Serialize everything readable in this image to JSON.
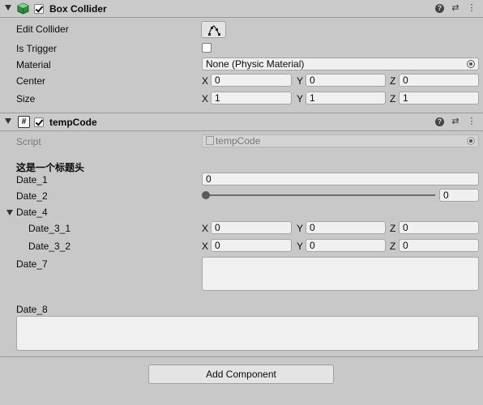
{
  "box_collider": {
    "title": "Box Collider",
    "enabled": true,
    "help_icon": "?",
    "preset_icon": "⇄",
    "menu_icon": "⋮",
    "edit_collider_label": "Edit Collider",
    "edit_collider_icon": "edit-collider-icon",
    "is_trigger_label": "Is Trigger",
    "is_trigger_checked": false,
    "material_label": "Material",
    "material_value": "None (Physic Material)",
    "center_label": "Center",
    "center": {
      "x": "0",
      "y": "0",
      "z": "0"
    },
    "size_label": "Size",
    "size": {
      "x": "1",
      "y": "1",
      "z": "1"
    },
    "axis_x": "X",
    "axis_y": "Y",
    "axis_z": "Z"
  },
  "temp_code": {
    "title": "tempCode",
    "enabled": true,
    "script_icon": "#",
    "script_label": "Script",
    "script_value": "tempCode",
    "section_header": "这是一个标题头",
    "date1_label": "Date_1",
    "date1_value": "0",
    "date2_label": "Date_2",
    "date2_value": "0",
    "date2_slider_fraction": 0,
    "date4_label": "Date_4",
    "date31_label": "Date_3_1",
    "date31": {
      "x": "0",
      "y": "0",
      "z": "0"
    },
    "date32_label": "Date_3_2",
    "date32": {
      "x": "0",
      "y": "0",
      "z": "0"
    },
    "date7_label": "Date_7",
    "date7_value": "",
    "date8_label": "Date_8",
    "date8_value": ""
  },
  "footer": {
    "add_component_label": "Add Component"
  }
}
